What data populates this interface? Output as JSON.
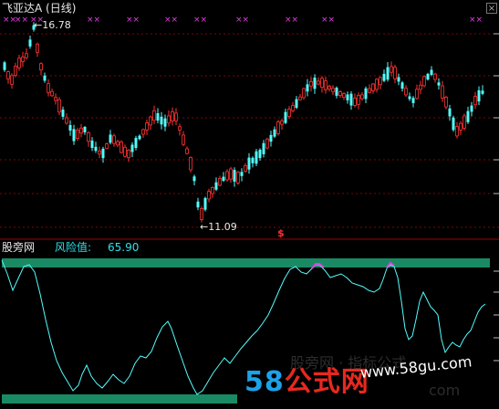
{
  "header": {
    "stock_title": "飞亚达A (日线)",
    "close_glyph": "×"
  },
  "price_chart": {
    "high_label": "16.78",
    "low_label": "11.09",
    "signal_mark": "$",
    "arrow": "←",
    "high_value": 16.78,
    "low_value": 11.09,
    "top_marker_glyph": "××",
    "top_marker_color": "#e040e0",
    "up_color": "#ff3232",
    "down_color": "#54fcfc",
    "grid_color": "#8a0000"
  },
  "risk_panel": {
    "title": "股旁网",
    "label": "风险值:",
    "value": "65.90",
    "line_color": "#54fcfc",
    "band_color": "#1a8a64",
    "peak_color": "#e040e0"
  },
  "watermark": {
    "num": "58",
    "cn": "公式网",
    "url": "www.58gu.com",
    "faint_text": "股旁网 · 指标公式",
    "faint_text2": "com"
  }
}
